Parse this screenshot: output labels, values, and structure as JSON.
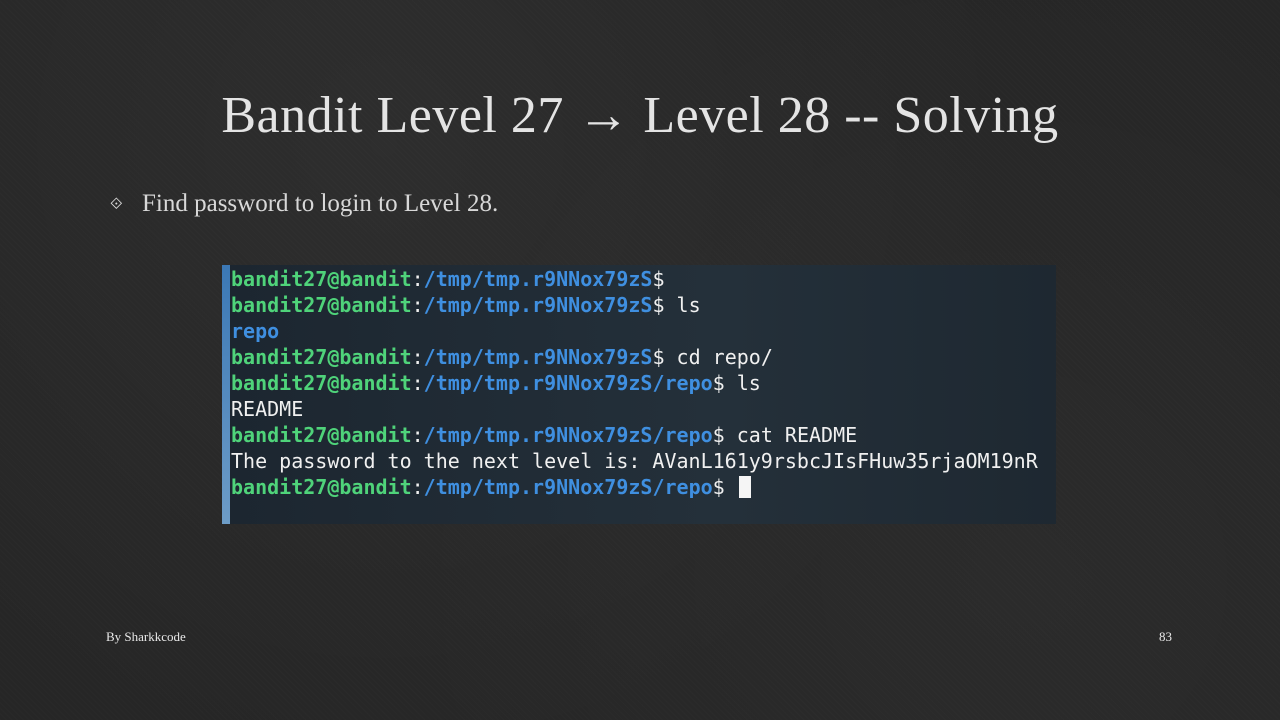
{
  "slide": {
    "title": "Bandit Level 27 → Level 28 -- Solving",
    "bullet_icon": "⟐",
    "bullet_text": "Find password to login to Level 28."
  },
  "terminal": {
    "lines": [
      {
        "user": "bandit27@bandit",
        "sep": ":",
        "path": "/tmp/tmp.r9NNox79zS",
        "prompt": "$",
        "cmd": ""
      },
      {
        "user": "bandit27@bandit",
        "sep": ":",
        "path": "/tmp/tmp.r9NNox79zS",
        "prompt": "$",
        "cmd": " ls"
      },
      {
        "dir": "repo"
      },
      {
        "user": "bandit27@bandit",
        "sep": ":",
        "path": "/tmp/tmp.r9NNox79zS",
        "prompt": "$",
        "cmd": " cd repo/"
      },
      {
        "user": "bandit27@bandit",
        "sep": ":",
        "path": "/tmp/tmp.r9NNox79zS/repo",
        "prompt": "$",
        "cmd": " ls"
      },
      {
        "output": "README"
      },
      {
        "user": "bandit27@bandit",
        "sep": ":",
        "path": "/tmp/tmp.r9NNox79zS/repo",
        "prompt": "$",
        "cmd": " cat README"
      },
      {
        "output": "The password to the next level is: AVanL161y9rsbcJIsFHuw35rjaOM19nR"
      },
      {
        "user": "bandit27@bandit",
        "sep": ":",
        "path": "/tmp/tmp.r9NNox79zS/repo",
        "prompt": "$",
        "cmd": " ",
        "cursor": true
      }
    ]
  },
  "footer": {
    "author": "By Sharkkcode",
    "page_number": "83"
  },
  "colors": {
    "background": "#262626",
    "terminal_user": "#4fd37a",
    "terminal_path": "#3f8fe0",
    "terminal_text": "#f0f0f0",
    "terminal_edge": "#3b78b5"
  }
}
